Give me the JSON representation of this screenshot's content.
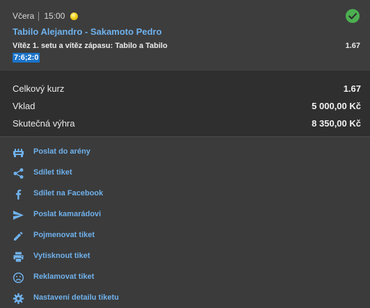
{
  "bet": {
    "day": "Včera",
    "time": "15:00",
    "event": "Tabilo Alejandro - Sakamoto Pedro",
    "market": "Vítěz 1. setu a vítěz zápasu: Tabilo a Tabilo",
    "odds": "1.67",
    "score": "7:6;2:0",
    "status_icon": "check-circle-icon",
    "status_color": "#4caf50"
  },
  "summary": {
    "total_odds_label": "Celkový kurz",
    "total_odds_value": "1.67",
    "stake_label": "Vklad",
    "stake_value": "5 000,00 Kč",
    "win_label": "Skutečná výhra",
    "win_value": "8 350,00 Kč"
  },
  "actions": [
    {
      "label": "Poslat do arény",
      "icon": "arena-icon"
    },
    {
      "label": "Sdílet tiket",
      "icon": "share-icon"
    },
    {
      "label": "Sdílet na Facebook",
      "icon": "facebook-icon"
    },
    {
      "label": "Poslat kamarádovi",
      "icon": "send-icon"
    },
    {
      "label": "Pojmenovat tiket",
      "icon": "pencil-icon"
    },
    {
      "label": "Vytisknout tiket",
      "icon": "printer-icon"
    },
    {
      "label": "Reklamovat tiket",
      "icon": "sad-face-icon"
    },
    {
      "label": "Nastavení detailu tiketu",
      "icon": "gear-icon"
    }
  ],
  "colors": {
    "link": "#6fb1ec",
    "score_bg": "#1a73c8"
  }
}
